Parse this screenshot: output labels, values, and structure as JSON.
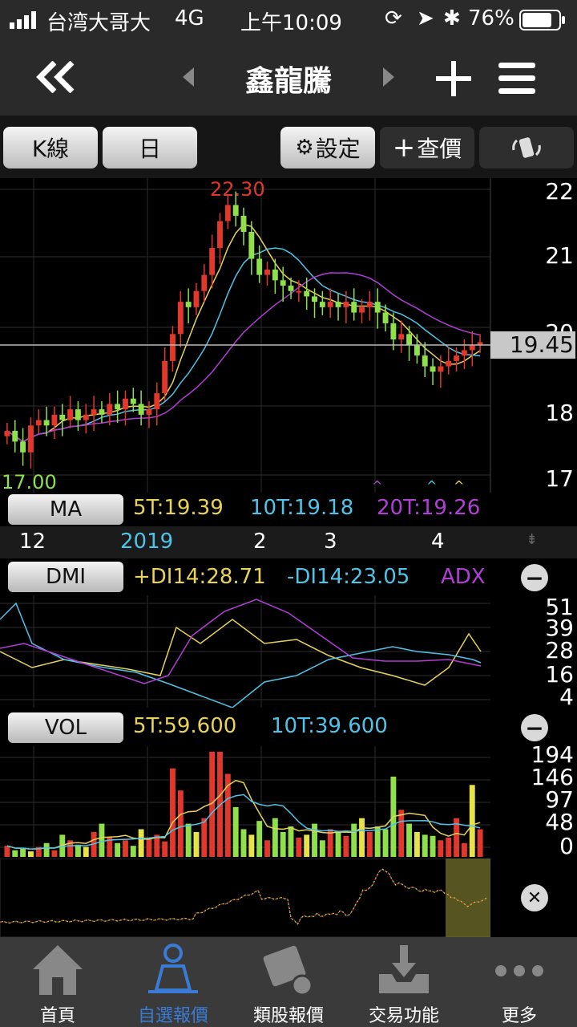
{
  "status_bar": {
    "carrier": "台湾大哥大",
    "network": "4G",
    "time": "上午10:09",
    "battery": "76%",
    "icons": [
      "signal-icon",
      "orientation-lock-icon",
      "location-icon",
      "bluetooth-icon",
      "battery-icon"
    ]
  },
  "nav": {
    "title": "鑫龍騰",
    "icons": [
      "double-chevron-left-icon",
      "prev-triangle-icon",
      "next-triangle-icon",
      "plus-icon",
      "hamburger-menu-icon"
    ]
  },
  "toolbar": {
    "kline_label": "K線",
    "period_label": "日",
    "settings_label": "設定",
    "quote_label": "查價"
  },
  "chart_data": [
    {
      "type": "candlestick",
      "price_axis_ticks": [
        "22",
        "21",
        "20",
        "18",
        "17"
      ],
      "high_label": "22.30",
      "low_label": "17.00",
      "current_price": "19.45",
      "indicator_name": "MA",
      "series": [
        {
          "name": "5T",
          "value_label": "5T:19.39",
          "color": "#e8d35a"
        },
        {
          "name": "10T",
          "value_label": "10T:19.18",
          "color": "#4fc3e8"
        },
        {
          "name": "20T",
          "value_label": "20T:19.26",
          "color": "#b13ed6"
        }
      ],
      "date_axis": [
        "12",
        "2019",
        "2",
        "3",
        "4"
      ],
      "closes": [
        17.8,
        17.6,
        17.4,
        17.9,
        18.0,
        17.9,
        18.1,
        18.0,
        18.2,
        18.0,
        18.1,
        18.2,
        18.1,
        18.3,
        18.2,
        18.4,
        18.3,
        18.1,
        18.2,
        18.5,
        19.1,
        19.6,
        20.2,
        20.1,
        20.4,
        20.7,
        21.2,
        21.7,
        22.0,
        21.8,
        21.5,
        21.0,
        20.7,
        20.8,
        20.6,
        20.5,
        20.4,
        20.4,
        20.3,
        20.2,
        20.1,
        20.2,
        20.1,
        20.2,
        20.0,
        20.1,
        20.2,
        20.0,
        19.8,
        19.5,
        19.6,
        19.4,
        19.2,
        19.0,
        18.9,
        19.0,
        19.1,
        19.2,
        19.3,
        19.4,
        19.45
      ]
    },
    {
      "type": "line",
      "indicator_name": "DMI",
      "series": [
        {
          "name": "+DI14",
          "value_label": "+DI14:28.71",
          "color": "#e8d35a"
        },
        {
          "name": "-DI14",
          "value_label": "-DI14:23.05",
          "color": "#4fc3e8"
        },
        {
          "name": "ADX",
          "value_label": "ADX",
          "color": "#b13ed6"
        }
      ],
      "y_ticks": [
        "51",
        "39",
        "28",
        "16",
        "4"
      ]
    },
    {
      "type": "bar",
      "indicator_name": "VOL",
      "series": [
        {
          "name": "5T",
          "value_label": "5T:59.600",
          "color": "#e8d35a"
        },
        {
          "name": "10T",
          "value_label": "10T:39.600",
          "color": "#4fc3e8"
        }
      ],
      "y_ticks": [
        "194",
        "146",
        "97",
        "48",
        "0"
      ],
      "volumes": [
        20,
        12,
        15,
        10,
        18,
        25,
        12,
        40,
        30,
        22,
        18,
        45,
        60,
        35,
        25,
        30,
        20,
        50,
        35,
        40,
        28,
        160,
        120,
        60,
        45,
        70,
        190,
        190,
        150,
        90,
        50,
        40,
        65,
        30,
        70,
        45,
        55,
        35,
        40,
        60,
        30,
        50,
        45,
        38,
        60,
        70,
        45,
        55,
        50,
        145,
        85,
        60,
        45,
        40,
        38,
        30,
        35,
        70,
        25,
        130,
        50
      ]
    }
  ],
  "tabs": [
    {
      "label": "首頁",
      "icon": "home-icon"
    },
    {
      "label": "自選報價",
      "icon": "watchlist-person-icon"
    },
    {
      "label": "類股報價",
      "icon": "film-dollar-icon"
    },
    {
      "label": "交易功能",
      "icon": "inbox-download-icon"
    },
    {
      "label": "更多",
      "icon": "more-dots-icon"
    }
  ],
  "colors": {
    "up": "#e0382c",
    "down": "#8fe04a",
    "accent_tab": "#3a7bd5"
  }
}
